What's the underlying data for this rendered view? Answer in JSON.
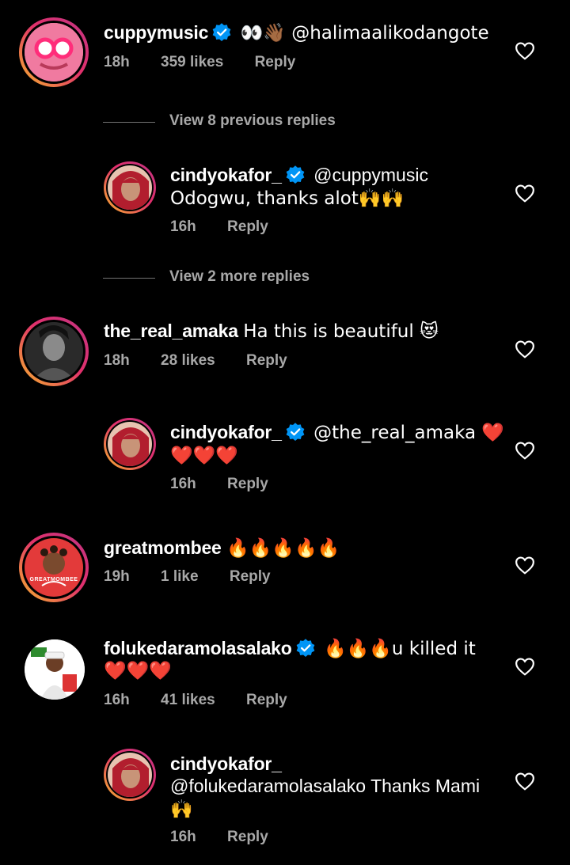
{
  "comments": [
    {
      "username": "cuppymusic",
      "verified": true,
      "text": "👀👋🏾 @halimaalikodangote",
      "time": "18h",
      "likes": "359 likes",
      "reply": "Reply",
      "avatar_color": "#e86a8f"
    },
    {
      "username": "cindyokafor_",
      "verified": true,
      "text_line1": "@cuppymusic",
      "text_line2": "Odogwu, thanks alot🙌🙌",
      "time": "16h",
      "reply": "Reply",
      "avatar_color": "#c23a3a"
    },
    {
      "username": "the_real_amaka",
      "text": "Ha this is beautiful 😻",
      "time": "18h",
      "likes": "28 likes",
      "reply": "Reply",
      "avatar_color": "#3a3a3a"
    },
    {
      "username": "cindyokafor_",
      "verified": true,
      "text_line1": "@the_real_amaka ❤️",
      "text_line2": "❤️❤️❤️",
      "time": "16h",
      "reply": "Reply",
      "avatar_color": "#c23a3a"
    },
    {
      "username": "greatmombee",
      "text": "🔥🔥🔥🔥🔥",
      "time": "19h",
      "likes": "1 like",
      "reply": "Reply",
      "avatar_color": "#e33a3a",
      "avatar_text": "GREATMOMBEE"
    },
    {
      "username": "folukedaramolasalako",
      "verified": true,
      "text_line1": "🔥🔥🔥u killed it",
      "text_line2": "❤️❤️❤️",
      "time": "16h",
      "likes": "41 likes",
      "reply": "Reply",
      "avatar_color": "#ffffff"
    },
    {
      "username": "cindyokafor_",
      "text_line1": "@folukedaramolasalako Thanks Mami",
      "text_line2": "🙌",
      "time": "16h",
      "reply": "Reply",
      "avatar_color": "#c23a3a"
    }
  ],
  "dividers": [
    {
      "label": "View 8 previous replies"
    },
    {
      "label": "View 2 more replies"
    }
  ],
  "colors": {
    "background": "#000000",
    "meta": "#a8a8a8",
    "verified": "#0095f6",
    "heart_outline": "#ffffff"
  },
  "icons": {
    "like": "heart-outline-icon",
    "verified": "verified-badge-icon"
  }
}
